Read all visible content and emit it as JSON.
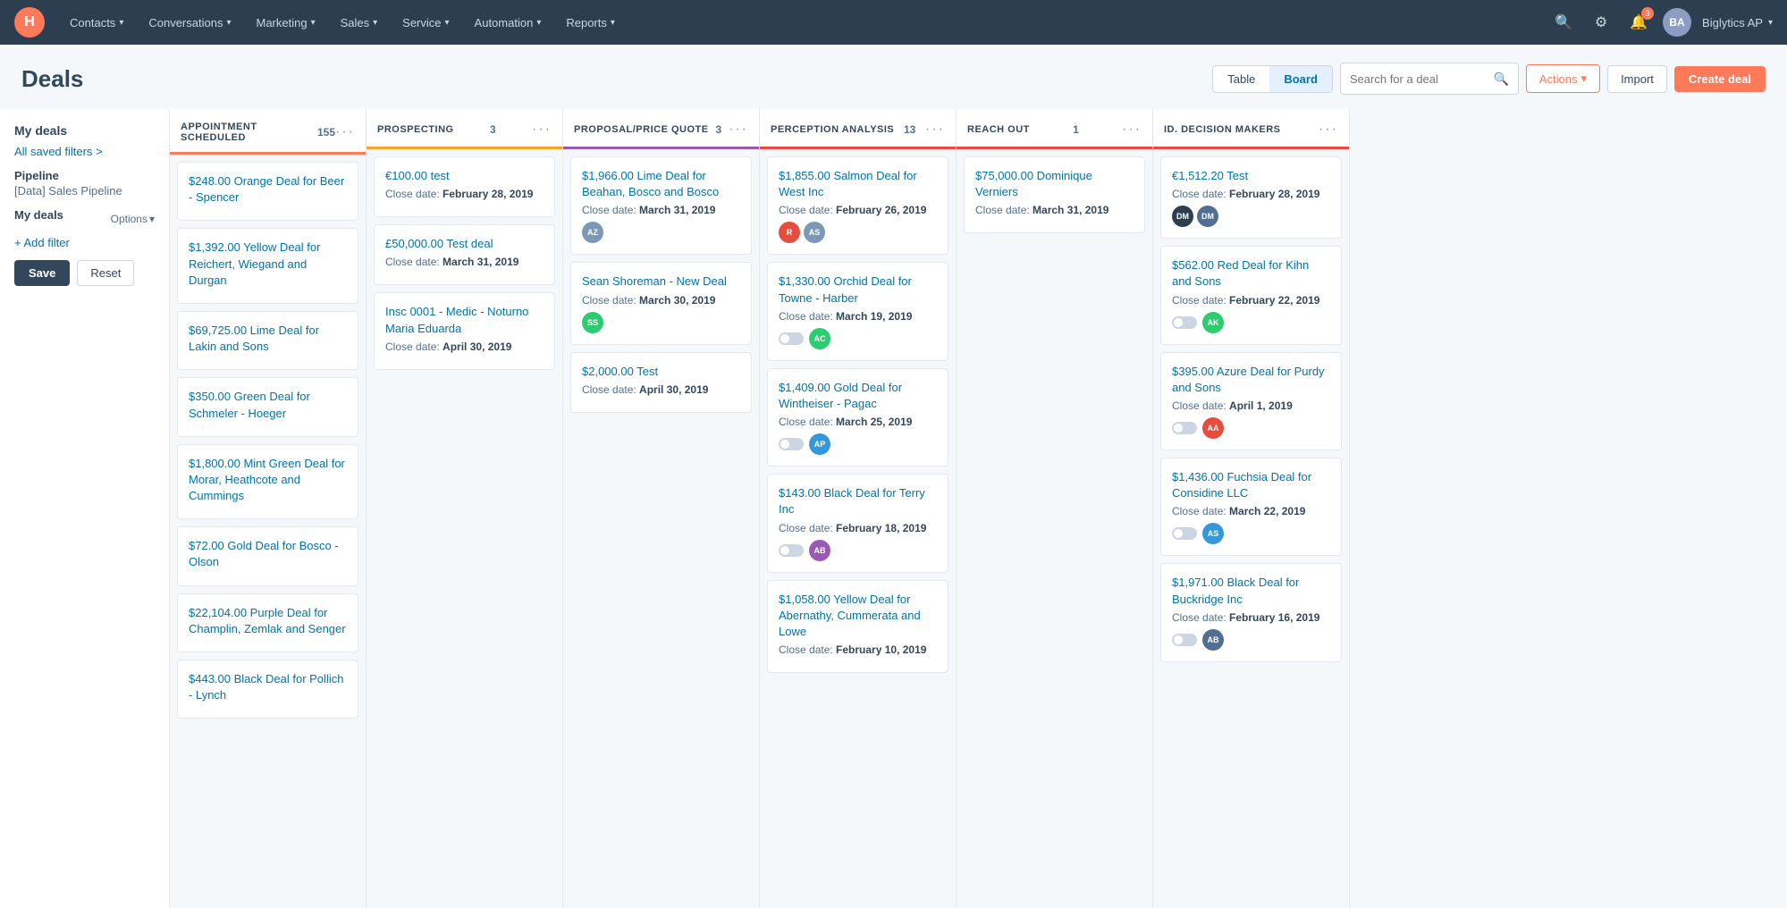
{
  "topnav": {
    "logo": "H",
    "items": [
      {
        "label": "Contacts",
        "id": "contacts"
      },
      {
        "label": "Conversations",
        "id": "conversations"
      },
      {
        "label": "Marketing",
        "id": "marketing"
      },
      {
        "label": "Sales",
        "id": "sales"
      },
      {
        "label": "Service",
        "id": "service"
      },
      {
        "label": "Automation",
        "id": "automation"
      },
      {
        "label": "Reports",
        "id": "reports"
      }
    ],
    "user": "Biglytics AP",
    "notification_count": "3"
  },
  "page": {
    "title": "Deals"
  },
  "header_controls": {
    "view_table": "Table",
    "view_board": "Board",
    "search_placeholder": "Search for a deal",
    "actions_label": "Actions",
    "import_label": "Import",
    "create_label": "Create deal"
  },
  "sidebar": {
    "title": "My deals",
    "saved_filters_link": "All saved filters >",
    "pipeline_label": "Pipeline",
    "pipeline_value": "[Data] Sales Pipeline",
    "my_deals_label": "My deals",
    "options_label": "Options",
    "add_filter_label": "+ Add filter",
    "save_label": "Save",
    "reset_label": "Reset"
  },
  "columns": [
    {
      "id": "appointment_scheduled",
      "name": "APPOINTMENT SCHEDULED",
      "count": "155",
      "color_class": "appointment",
      "cards": [
        {
          "name": "$248.00 Orange Deal for Beer - Spencer",
          "date": ""
        },
        {
          "name": "$1,392.00 Yellow Deal for Reichert, Wiegand and Durgan",
          "date": ""
        },
        {
          "name": "$69,725.00 Lime Deal for Lakin and Sons",
          "date": ""
        },
        {
          "name": "$350.00 Green Deal for Schmeler - Hoeger",
          "date": ""
        },
        {
          "name": "$1,800.00 Mint Green Deal for Morar, Heathcote and Cummings",
          "date": ""
        },
        {
          "name": "$72.00 Gold Deal for Bosco - Olson",
          "date": ""
        },
        {
          "name": "$22,104.00 Purple Deal for Champlin, Zemlak and Senger",
          "date": ""
        },
        {
          "name": "$443.00 Black Deal for Pollich - Lynch",
          "date": ""
        }
      ]
    },
    {
      "id": "prospecting",
      "name": "PROSPECTING",
      "count": "3",
      "color_class": "prospecting",
      "cards": [
        {
          "name": "€100.00 test",
          "date": "February 28, 2019",
          "has_avatar": false
        },
        {
          "name": "£50,000.00 Test deal",
          "date": "March 31, 2019",
          "has_avatar": false
        },
        {
          "name": "Insc 0001 - Medic - Noturno Maria Eduarda",
          "date": "April 30, 2019",
          "has_avatar": false
        }
      ]
    },
    {
      "id": "proposal_price_quote",
      "name": "PROPOSAL/PRICE QUOTE",
      "count": "3",
      "color_class": "proposal",
      "cards": [
        {
          "name": "$1,966.00 Lime Deal for Beahan, Bosco and Bosco",
          "date": "March 31, 2019",
          "avatars": [
            {
              "initials": "AZ",
              "color": "#7c98b6"
            }
          ]
        },
        {
          "name": "Sean Shoreman - New Deal",
          "date": "March 30, 2019",
          "avatars": [
            {
              "initials": "SS",
              "color": "#6cb; background:#6cb"
            }
          ]
        },
        {
          "name": "$2,000.00 Test",
          "date": "April 30, 2019",
          "has_avatar": false
        }
      ]
    },
    {
      "id": "perception_analysis",
      "name": "PERCEPTION ANALYSIS",
      "count": "13",
      "color_class": "perception",
      "cards": [
        {
          "name": "$1,855.00 Salmon Deal for West Inc",
          "date": "February 26, 2019",
          "avatars": [
            {
              "initials": "R",
              "color": "#e74c3c"
            },
            {
              "initials": "AS",
              "color": "#7c98b6"
            }
          ]
        },
        {
          "name": "$1,330.00 Orchid Deal for Towne - Harber",
          "date": "March 19, 2019",
          "avatars": [
            {
              "initials": "AC",
              "color": "#2ecc71"
            }
          ]
        },
        {
          "name": "$1,409.00 Gold Deal for Wintheiser - Pagac",
          "date": "March 25, 2019",
          "avatars": [
            {
              "initials": "AP",
              "color": "#3498db"
            }
          ]
        },
        {
          "name": "$143.00 Black Deal for Terry Inc",
          "date": "February 18, 2019",
          "avatars": [
            {
              "initials": "AB",
              "color": "#9b59b6"
            }
          ]
        },
        {
          "name": "$1,058.00 Yellow Deal for Abernathy, Cummerata and Lowe",
          "date": "February 10, 2019",
          "has_avatar": false
        }
      ]
    },
    {
      "id": "reach_out",
      "name": "REACH OUT",
      "count": "1",
      "color_class": "reachout",
      "cards": [
        {
          "name": "$75,000.00 Dominique Verniers",
          "date": "March 31, 2019",
          "has_avatar": false
        }
      ]
    },
    {
      "id": "id_decision_makers",
      "name": "ID. DECISION MAKERS",
      "count": "",
      "color_class": "decision",
      "cards": [
        {
          "name": "€1,512.20 Test",
          "date": "February 28, 2019",
          "avatars": [
            {
              "initials": "DM",
              "color": "#2d3e50"
            },
            {
              "initials": "DM",
              "color": "#516f90"
            }
          ]
        },
        {
          "name": "$562.00 Red Deal for Kihn and Sons",
          "date": "February 22, 2019",
          "avatars": [
            {
              "initials": "AK",
              "color": "#2ecc71"
            }
          ]
        },
        {
          "name": "$395.00 Azure Deal for Purdy and Sons",
          "date": "April 1, 2019",
          "avatars": [
            {
              "initials": "AA",
              "color": "#e74c3c"
            }
          ]
        },
        {
          "name": "$1,436.00 Fuchsia Deal for Considine LLC",
          "date": "March 22, 2019",
          "avatars": [
            {
              "initials": "AS",
              "color": "#3498db"
            }
          ]
        },
        {
          "name": "$1,971.00 Black Deal for Buckridge Inc",
          "date": "February 16, 2019",
          "avatars": [
            {
              "initials": "AB",
              "color": "#516f90"
            }
          ]
        }
      ]
    }
  ],
  "colors": {
    "primary": "#ff7a59",
    "link": "#0073aa",
    "dark": "#33475b",
    "medium": "#516f90",
    "light": "#cbd6e2"
  }
}
